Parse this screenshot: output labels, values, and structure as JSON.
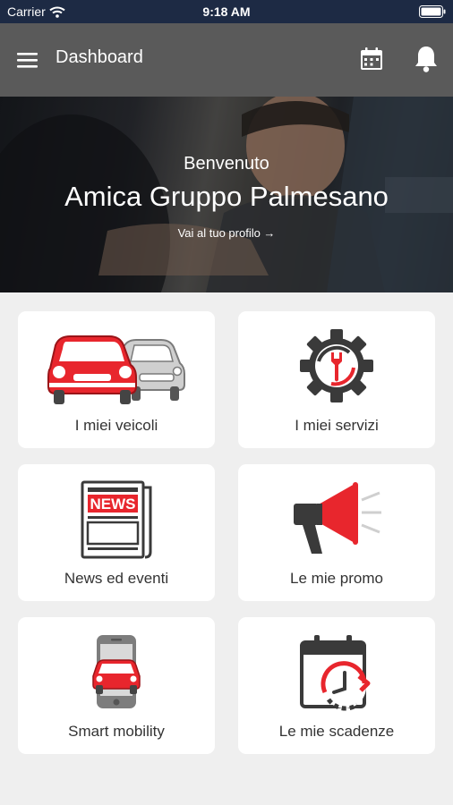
{
  "status_bar": {
    "carrier": "Carrier",
    "time": "9:18 AM"
  },
  "header": {
    "title": "Dashboard"
  },
  "hero": {
    "greeting": "Benvenuto",
    "name": "Amica Gruppo Palmesano",
    "profile_link": "Vai al tuo profilo →"
  },
  "tiles": [
    {
      "label": "I miei veicoli",
      "icon": "car-icon"
    },
    {
      "label": "I miei servizi",
      "icon": "gear-wrench-icon"
    },
    {
      "label": "News ed eventi",
      "icon": "newspaper-icon",
      "badge": "NEWS"
    },
    {
      "label": "Le mie promo",
      "icon": "megaphone-icon"
    },
    {
      "label": "Smart mobility",
      "icon": "smartphone-car-icon"
    },
    {
      "label": "Le mie scadenze",
      "icon": "calendar-clock-icon"
    }
  ],
  "colors": {
    "accent": "#e8262d",
    "icon_dark": "#3a3a3a",
    "header": "#5a5a5a",
    "status_bar": "#1d2a44"
  }
}
